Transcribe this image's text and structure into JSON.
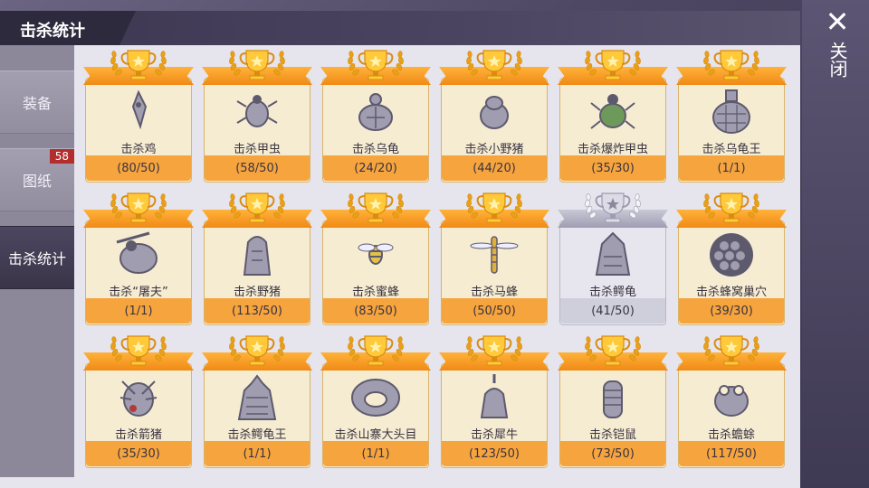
{
  "header": {
    "title": "击杀统计"
  },
  "sidebar": {
    "items": [
      {
        "label": "装备",
        "active": false
      },
      {
        "label": "图纸",
        "active": false,
        "badge": "58"
      },
      {
        "label": "击杀统计",
        "active": true
      }
    ]
  },
  "close": {
    "label": "关闭",
    "icon": "close-icon"
  },
  "colors": {
    "gold_ribbon": "#f08a16",
    "card_bg": "#f5ecd2",
    "silver_ribbon": "#9f9db2",
    "badge": "#b32d2d"
  },
  "achievements": [
    {
      "name": "击杀鸡",
      "progress": "(80/50)",
      "tier": "gold",
      "icon": "chicken-icon"
    },
    {
      "name": "击杀甲虫",
      "progress": "(58/50)",
      "tier": "gold",
      "icon": "beetle-icon"
    },
    {
      "name": "击杀乌龟",
      "progress": "(24/20)",
      "tier": "gold",
      "icon": "turtle-icon"
    },
    {
      "name": "击杀小野猪",
      "progress": "(44/20)",
      "tier": "gold",
      "icon": "piglet-icon"
    },
    {
      "name": "击杀爆炸甲虫",
      "progress": "(35/30)",
      "tier": "gold",
      "icon": "explosive-beetle-icon"
    },
    {
      "name": "击杀乌龟王",
      "progress": "(1/1)",
      "tier": "gold",
      "icon": "turtle-king-icon"
    },
    {
      "name": "击杀“屠夫”",
      "progress": "(1/1)",
      "tier": "gold",
      "icon": "butcher-icon"
    },
    {
      "name": "击杀野猪",
      "progress": "(113/50)",
      "tier": "gold",
      "icon": "boar-icon"
    },
    {
      "name": "击杀蜜蜂",
      "progress": "(83/50)",
      "tier": "gold",
      "icon": "bee-icon"
    },
    {
      "name": "击杀马蜂",
      "progress": "(50/50)",
      "tier": "gold",
      "icon": "wasp-icon"
    },
    {
      "name": "击杀鳄龟",
      "progress": "(41/50)",
      "tier": "silver",
      "icon": "snapping-turtle-icon"
    },
    {
      "name": "击杀蜂窝巢穴",
      "progress": "(39/30)",
      "tier": "gold",
      "icon": "hive-icon"
    },
    {
      "name": "击杀箭猪",
      "progress": "(35/30)",
      "tier": "gold",
      "icon": "porcupine-icon"
    },
    {
      "name": "击杀鳄龟王",
      "progress": "(1/1)",
      "tier": "gold",
      "icon": "snapping-turtle-king-icon"
    },
    {
      "name": "击杀山寨大头目",
      "progress": "(1/1)",
      "tier": "gold",
      "icon": "bandit-boss-icon"
    },
    {
      "name": "击杀犀牛",
      "progress": "(123/50)",
      "tier": "gold",
      "icon": "rhino-icon"
    },
    {
      "name": "击杀铠鼠",
      "progress": "(73/50)",
      "tier": "gold",
      "icon": "armadillo-icon"
    },
    {
      "name": "击杀蟾蜍",
      "progress": "(117/50)",
      "tier": "gold",
      "icon": "toad-icon"
    }
  ]
}
